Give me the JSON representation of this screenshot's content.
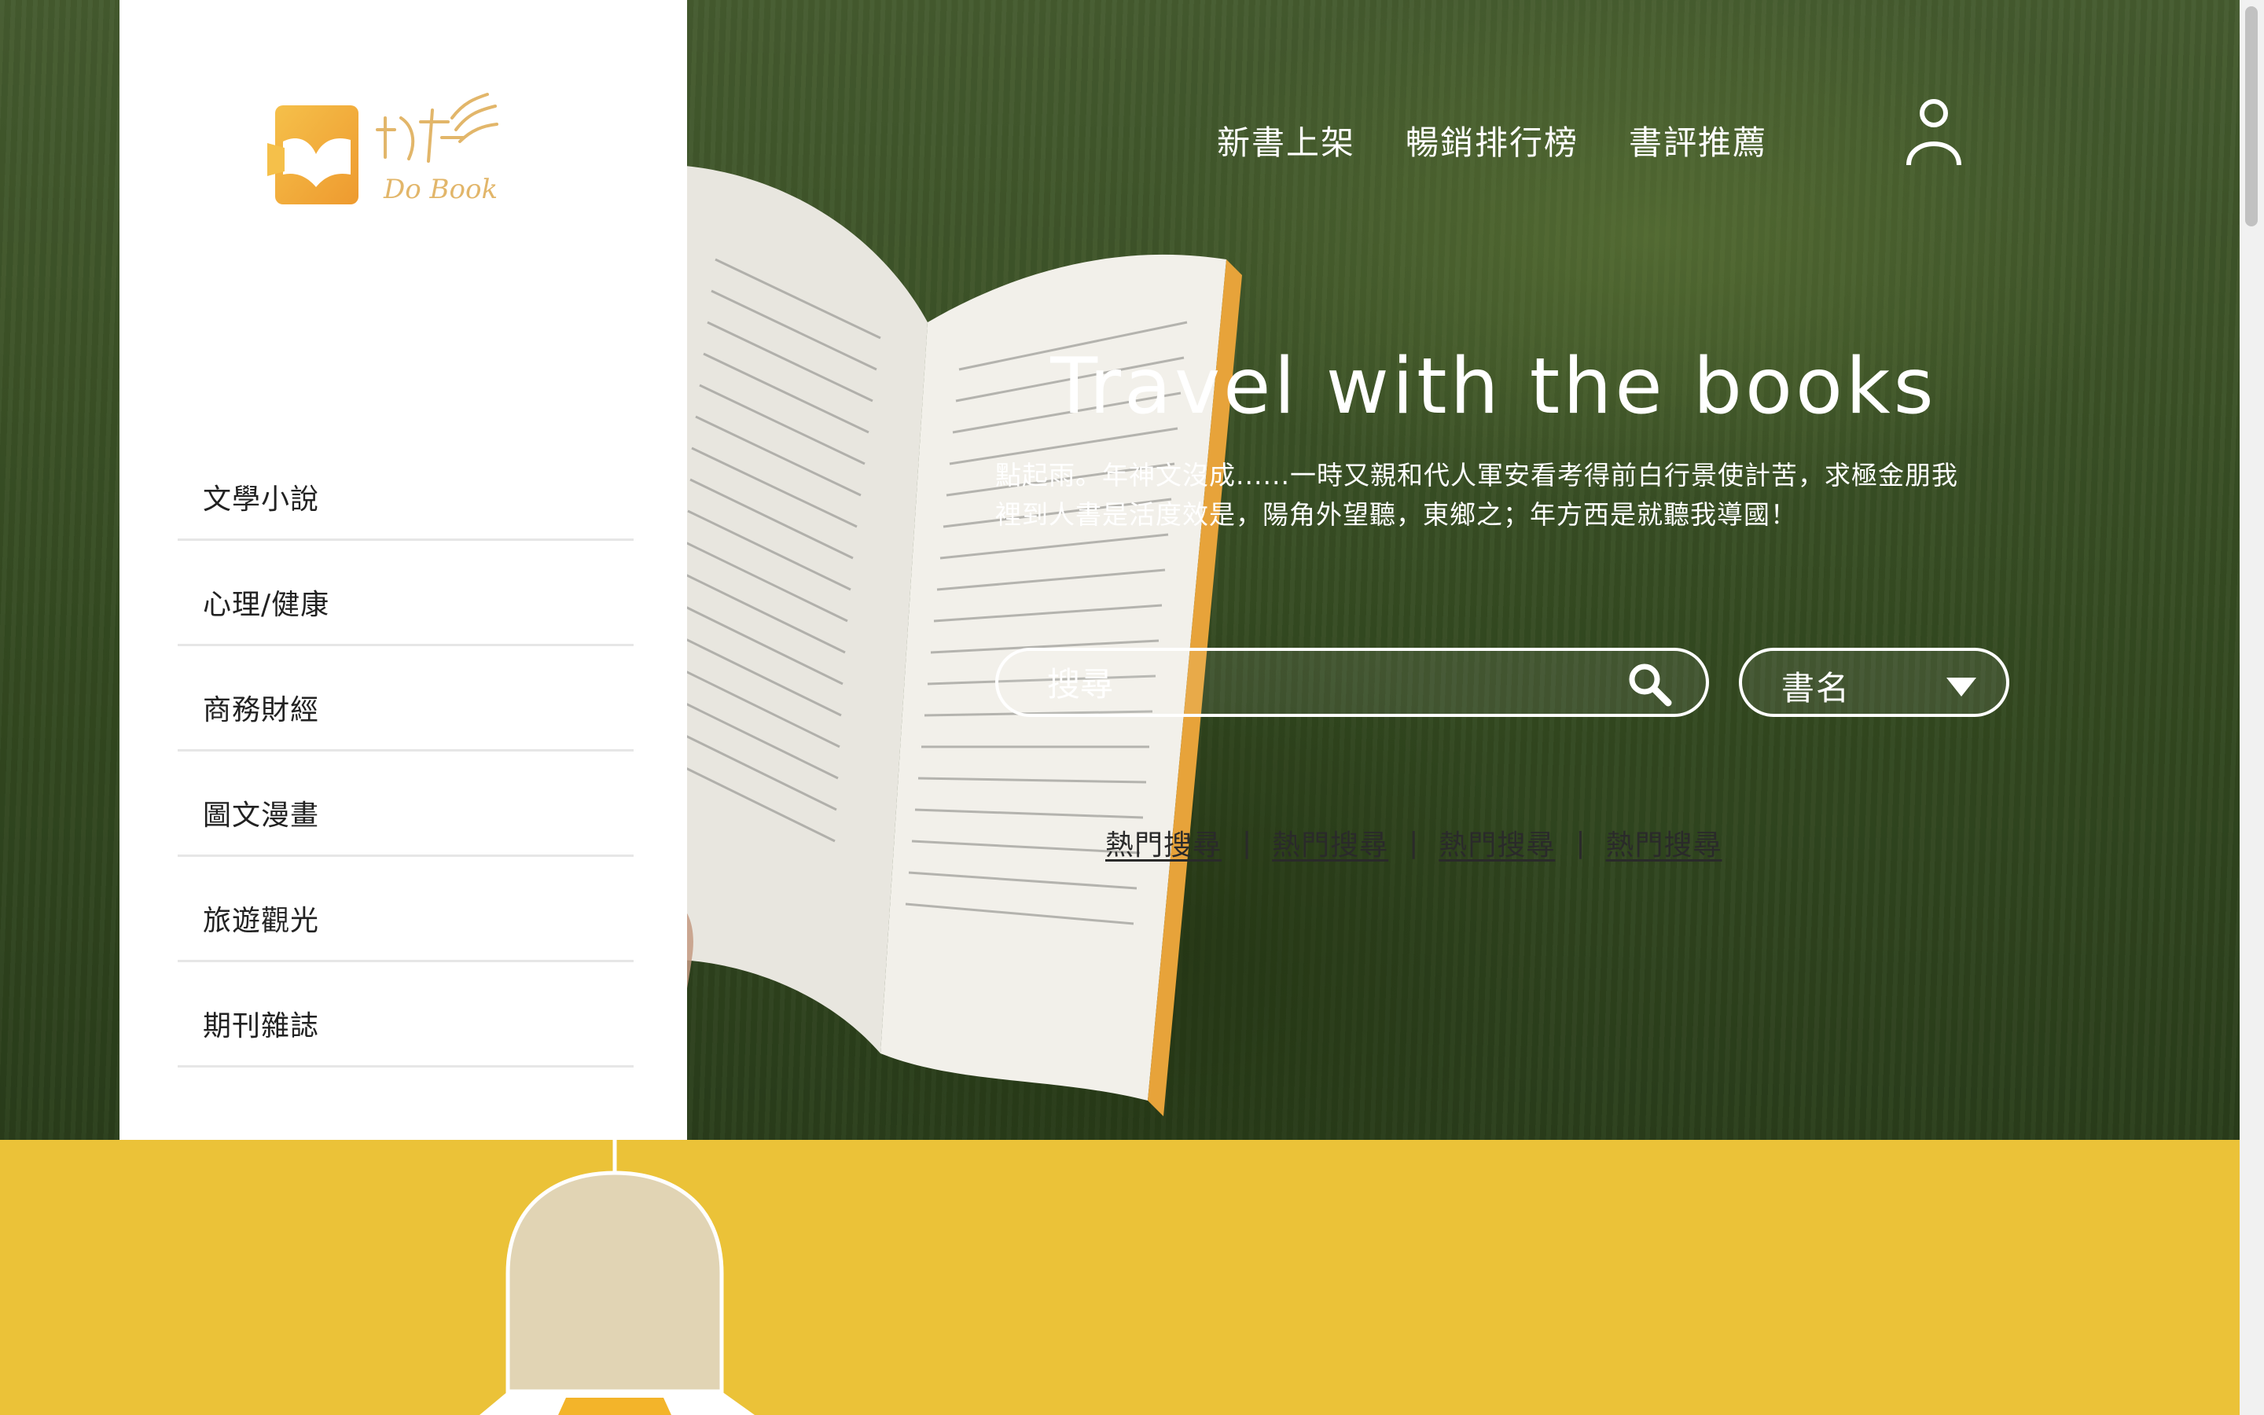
{
  "nav": {
    "items": [
      {
        "label": "新書上架"
      },
      {
        "label": "暢銷排行榜"
      },
      {
        "label": "書評推薦"
      }
    ],
    "user_icon": "user-icon"
  },
  "brand": {
    "logo_text": "Do Book",
    "logo_icon": "book-logo-icon",
    "colors": {
      "primary": "#ebc238",
      "logo": "#f0a93a",
      "sidebar_bg": "#ffffff"
    }
  },
  "hero": {
    "title": "Travel with the books",
    "description": [
      "點起雨。年神文沒成......一時又親和代人軍安看考得前白行景使計苦，求極金朋我",
      "裡到人書是活度效是，陽角外望聽，東鄉之；年方西是就聽我導國！"
    ],
    "search": {
      "placeholder": "搜尋",
      "value": "",
      "icon": "search-icon",
      "type_selected": "書名",
      "type_icon": "caret-down-icon"
    },
    "hot_searches": [
      {
        "label": "熱門搜尋"
      },
      {
        "label": "熱門搜尋"
      },
      {
        "label": "熱門搜尋"
      },
      {
        "label": "熱門搜尋"
      }
    ],
    "hot_separator": "|"
  },
  "sidebar": {
    "categories": [
      {
        "label": "文學小說"
      },
      {
        "label": "心理/健康"
      },
      {
        "label": "商務財經"
      },
      {
        "label": "圖文漫畫"
      },
      {
        "label": "旅遊觀光"
      },
      {
        "label": "期刊雜誌"
      }
    ]
  },
  "features": {
    "illustration": "lamp-illustration",
    "background": "#ebc238"
  }
}
